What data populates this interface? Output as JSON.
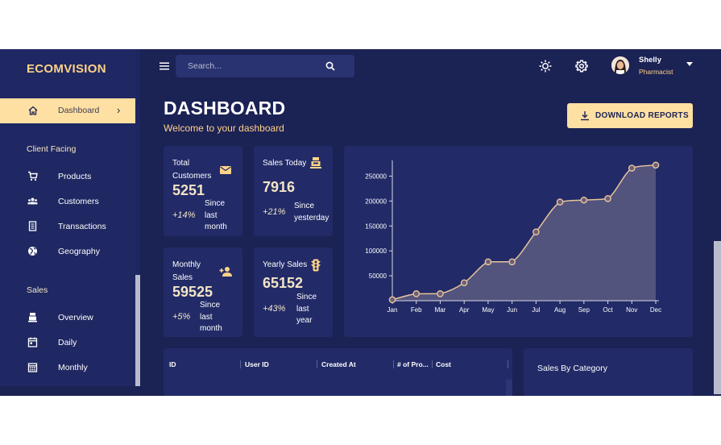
{
  "brand": "ECOMVISION",
  "sidebar": {
    "active": {
      "label": "Dashboard"
    },
    "sections": [
      {
        "title": "Client Facing",
        "items": [
          {
            "label": "Products",
            "icon": "shopping-cart-icon"
          },
          {
            "label": "Customers",
            "icon": "groups-icon"
          },
          {
            "label": "Transactions",
            "icon": "receipt-icon"
          },
          {
            "label": "Geography",
            "icon": "globe-icon"
          }
        ]
      },
      {
        "title": "Sales",
        "items": [
          {
            "label": "Overview",
            "icon": "point-of-sale-icon"
          },
          {
            "label": "Daily",
            "icon": "calendar-today-icon"
          },
          {
            "label": "Monthly",
            "icon": "calendar-month-icon"
          }
        ]
      }
    ]
  },
  "topbar": {
    "search_placeholder": "Search...",
    "user": {
      "name": "Shelly",
      "role": "Pharmacist"
    }
  },
  "header": {
    "title": "DASHBOARD",
    "subtitle": "Welcome to your dashboard",
    "download_label": "DOWNLOAD REPORTS"
  },
  "stats": {
    "total_customers": {
      "title_line1": "Total",
      "title_line2": "Customers",
      "value": "5251",
      "pct": "+14%",
      "note_line1": "Since",
      "note_line2": "last",
      "note_line3": "month",
      "icon": "email-icon"
    },
    "sales_today": {
      "title": "Sales Today",
      "value": "7916",
      "pct": "+21%",
      "note_line1": "Since",
      "note_line2": "yesterday",
      "icon": "point-of-sale-icon"
    },
    "monthly_sales": {
      "title_line1": "Monthly",
      "title_line2": "Sales",
      "value": "59525",
      "pct": "+5%",
      "note_line1": "Since",
      "note_line2": "last",
      "note_line3": "month",
      "icon": "person-add-icon"
    },
    "yearly_sales": {
      "title": "Yearly Sales",
      "value": "65152",
      "pct": "+43%",
      "note_line1": "Since",
      "note_line2": "last",
      "note_line3": "year",
      "icon": "traffic-icon"
    }
  },
  "table": {
    "columns": [
      "ID",
      "User ID",
      "Created At",
      "# of Pro...",
      "Cost"
    ]
  },
  "sales_by_category": {
    "title": "Sales By Category"
  },
  "colors": {
    "background": "#1b2254",
    "panel": "#222b67",
    "accent": "#ffe0a3",
    "accent_text": "#ffd28a",
    "line": "#e9c39b",
    "area": "#55567f"
  },
  "chart_data": {
    "type": "area",
    "categories": [
      "Jan",
      "Feb",
      "Mar",
      "Apr",
      "May",
      "Jun",
      "Jul",
      "Aug",
      "Sep",
      "Oct",
      "Nov",
      "Dec"
    ],
    "series": [
      {
        "values": [
          2000,
          14000,
          14000,
          36000,
          78000,
          78000,
          138000,
          198000,
          202000,
          205000,
          266000,
          272000
        ]
      }
    ],
    "yticks": [
      50000,
      100000,
      150000,
      200000,
      250000
    ],
    "ylim": [
      0,
      275000
    ],
    "grid": false
  }
}
